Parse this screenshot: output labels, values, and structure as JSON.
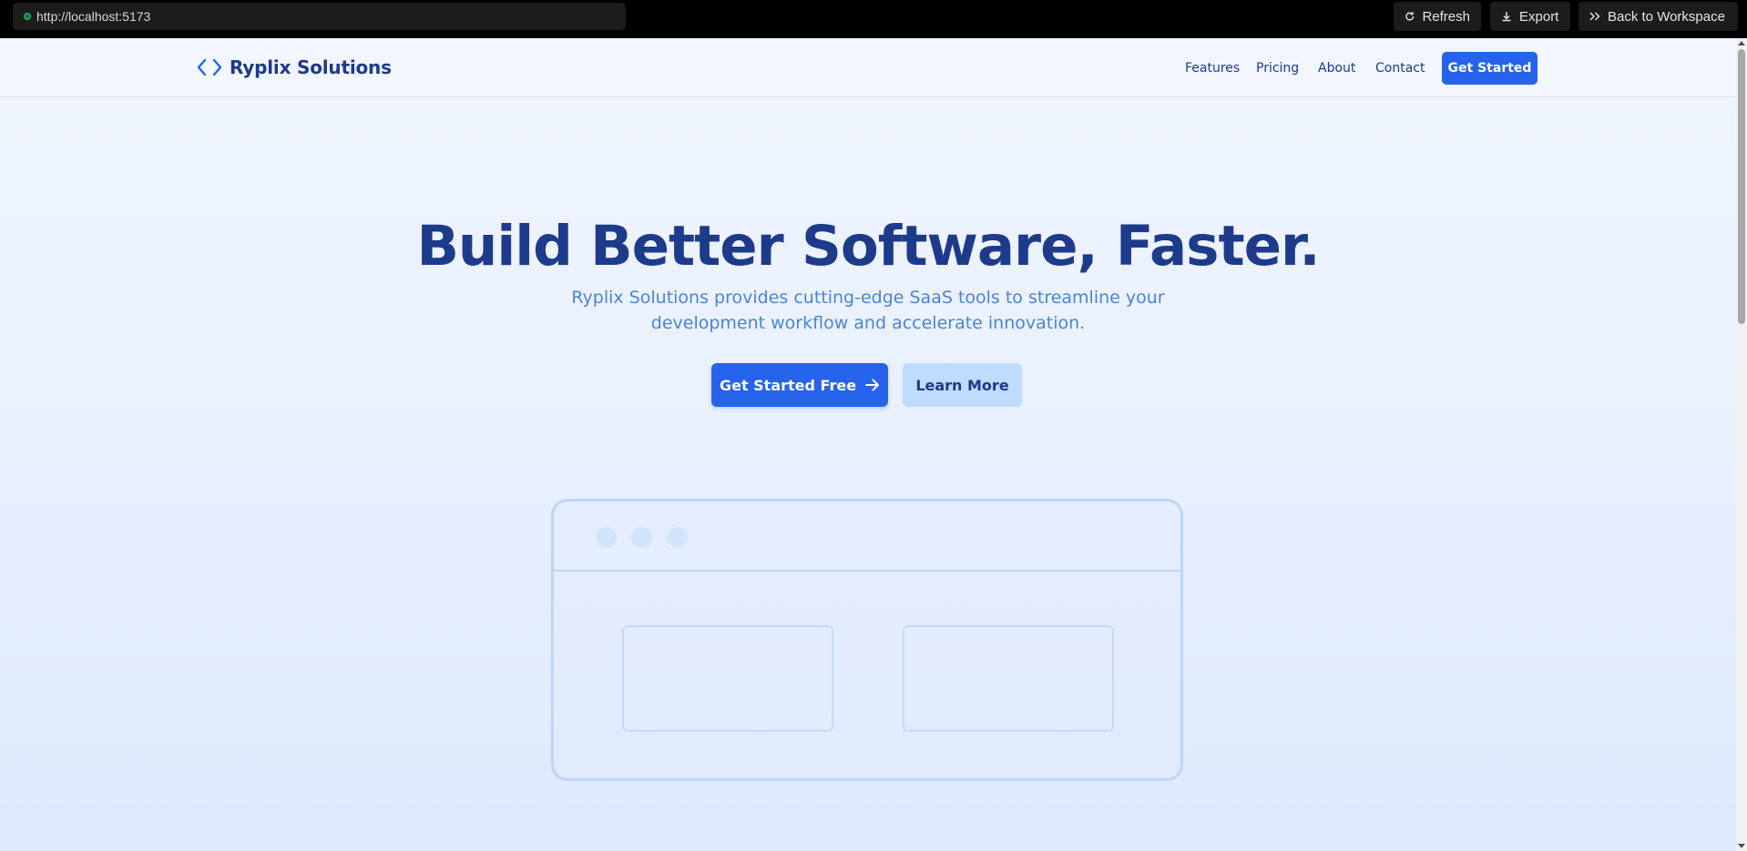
{
  "browser": {
    "url": "http://localhost:5173",
    "refresh_label": "Refresh",
    "export_label": "Export",
    "back_label": "Back to Workspace"
  },
  "site": {
    "brand": "Ryplix Solutions",
    "nav": {
      "features": "Features",
      "pricing": "Pricing",
      "about": "About",
      "contact": "Contact",
      "cta": "Get Started"
    },
    "hero": {
      "title": "Build Better Software, Faster.",
      "subtitle": "Ryplix Solutions provides cutting-edge SaaS tools to streamline your development workflow and accelerate innovation.",
      "primary_button": "Get Started Free",
      "secondary_button": "Learn More"
    }
  },
  "colors": {
    "accent": "#2563eb",
    "heading": "#1e3a8a",
    "subtitle": "#4a84d9",
    "secondary_button_bg": "#bfdbfe"
  }
}
